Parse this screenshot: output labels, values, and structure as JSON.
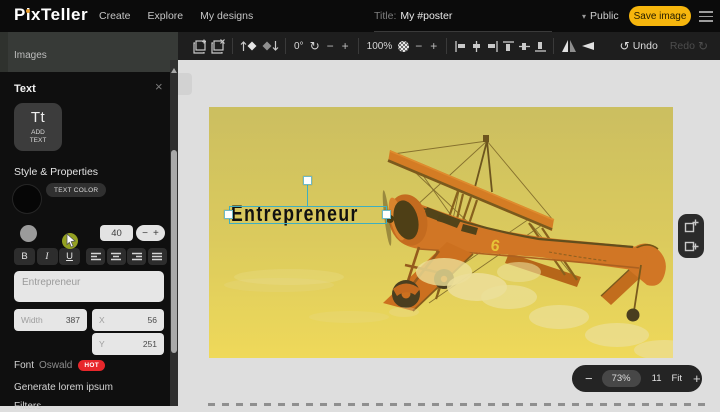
{
  "topbar": {
    "logo": "PixTeller",
    "nav": [
      {
        "label": "Create"
      },
      {
        "label": "Explore"
      },
      {
        "label": "My designs"
      }
    ],
    "title_label": "Title:",
    "title_value": "My #poster",
    "visibility": "Public",
    "save_button": "Save image"
  },
  "toolbar": {
    "rotation_value": "0°",
    "zoom_value": "100%",
    "minus": "−",
    "plus": "+",
    "undo_label": "Undo",
    "redo_label": "Redo",
    "undo_icon": "↺",
    "redo_icon": "↻"
  },
  "sidebar": {
    "images_label": "Images",
    "text_panel": {
      "title": "Text",
      "close": "×",
      "add_text_icon": "Tt",
      "add_text_label": "ADD\nTEXT",
      "style_heading": "Style & Properties",
      "text_color_label": "TEXT COLOR",
      "font_size": "40",
      "minus": "−",
      "plus": "+",
      "bold": "B",
      "italic": "I",
      "underline": "U",
      "text_value": "Entrepreneur",
      "width_label": "Width",
      "width_value": "387",
      "x_label": "X",
      "x_value": "56",
      "y_label": "Y",
      "y_value": "251",
      "font_label": "Font",
      "font_name": "Oswald",
      "font_badge": "HOT",
      "lorem_label": "Generate lorem ipsum",
      "filters_label": "Filters"
    }
  },
  "canvas": {
    "text": "Entrepreneur"
  },
  "zoombar": {
    "minus": "−",
    "zoom": "73%",
    "pages": "11",
    "fit": "Fit",
    "plus": "+"
  },
  "dropdown_caret": "▾",
  "colors": {
    "accent_yellow": "#f6b60d",
    "selection_teal": "#3fafbf",
    "hot_red": "#e8272b",
    "sky_top": "#c8bd62",
    "sky_bottom": "#f0db5c",
    "plane_orange": "#cf6a1f"
  }
}
